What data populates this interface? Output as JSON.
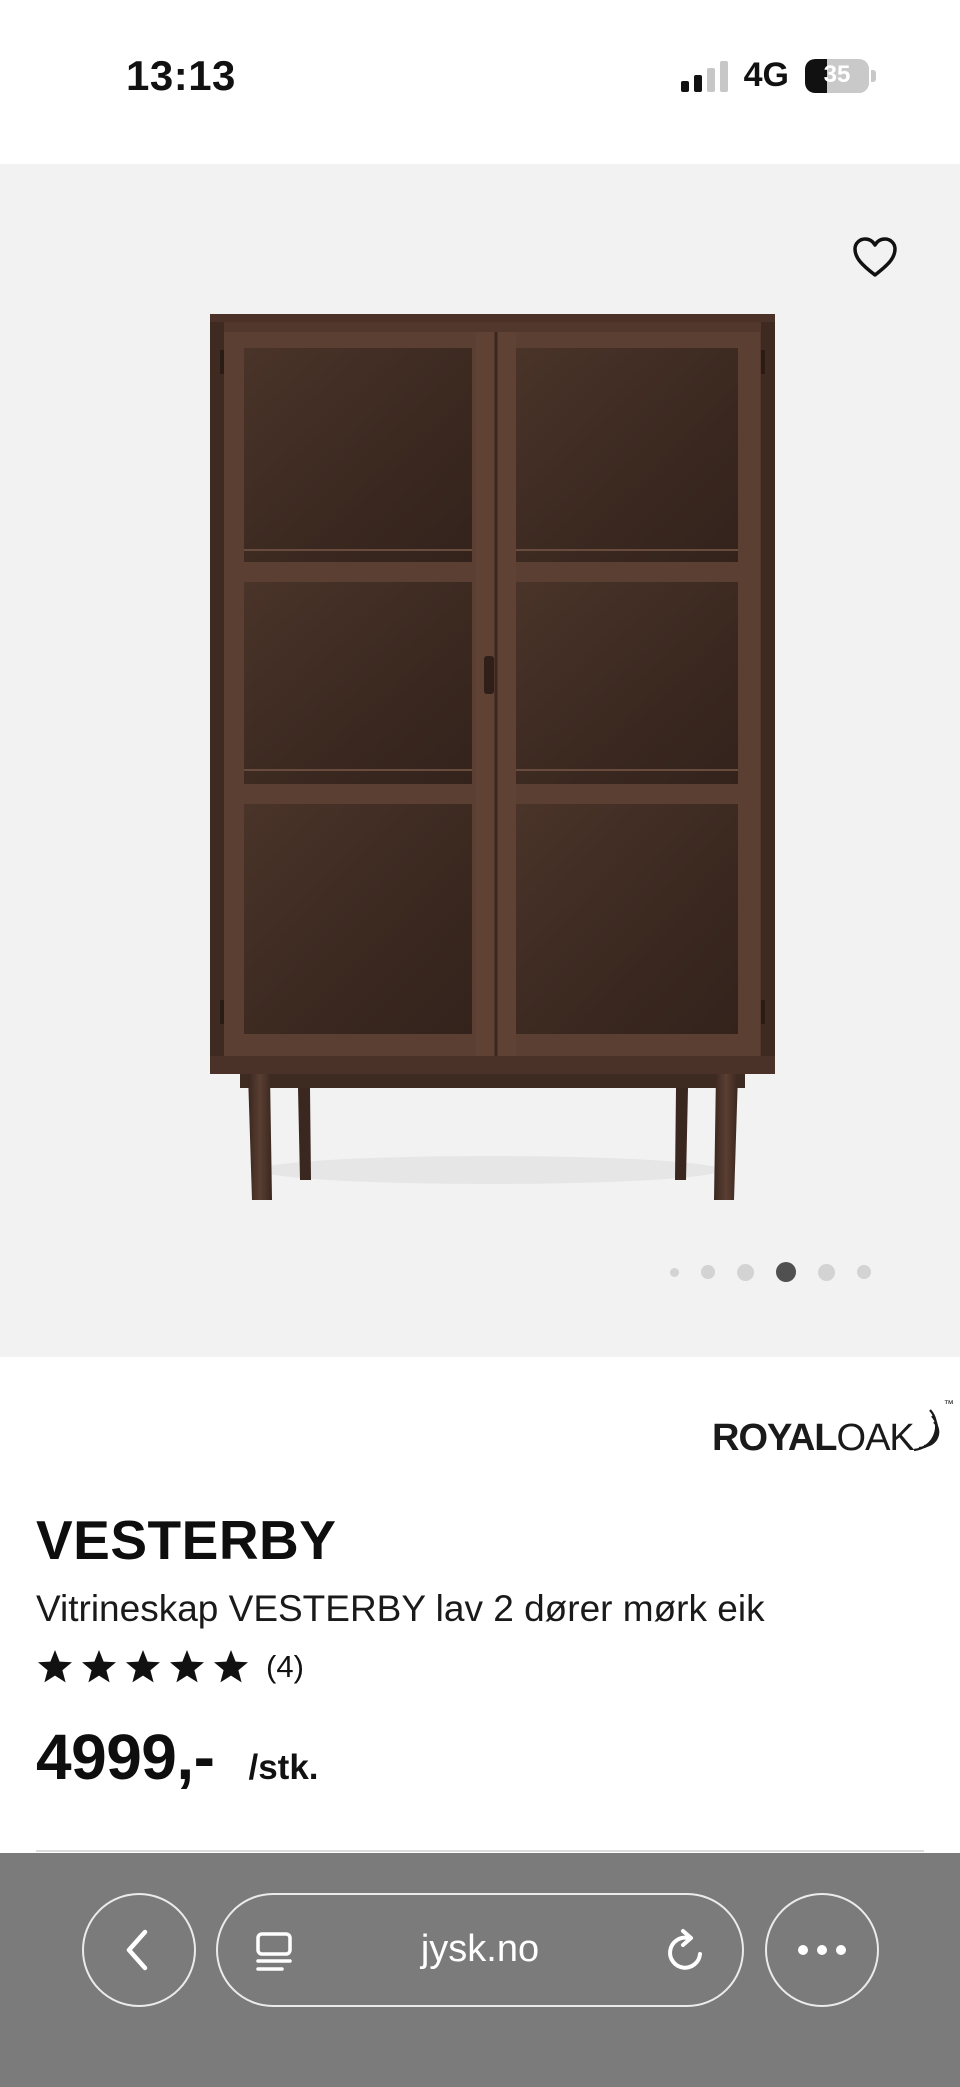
{
  "status": {
    "time": "13:13",
    "network": "4G",
    "battery": "35",
    "battery_level": 0.35,
    "signal_bars_active": 2
  },
  "gallery": {
    "image_alt": "Vitrineskap VESTERBY lav 2 dører mørk eik",
    "dot_count": 6,
    "active_dot": 3
  },
  "product": {
    "brand_part1": "ROYAL",
    "brand_part2": "OAK",
    "brand_tm": "™",
    "title": "VESTERBY",
    "subtitle": "Vitrineskap VESTERBY lav 2 dører mørk eik",
    "rating_stars": 5,
    "rating_count": "(4)",
    "price": "4999,-",
    "unit": "/stk."
  },
  "browser": {
    "url": "jysk.no"
  },
  "icons": {
    "wishlist": "heart-outline-icon",
    "back": "chevron-left-icon",
    "reader": "reader-mode-icon",
    "reload": "reload-icon",
    "more": "ellipsis-icon"
  },
  "colors": {
    "gallery_bg": "#f2f2f2",
    "wood_dark": "#3f2b22",
    "wood_mid": "#5a3f32",
    "browser_bar": "#7b7b7b",
    "dot_active": "#505050",
    "dot_inactive": "#d3d3d3"
  }
}
